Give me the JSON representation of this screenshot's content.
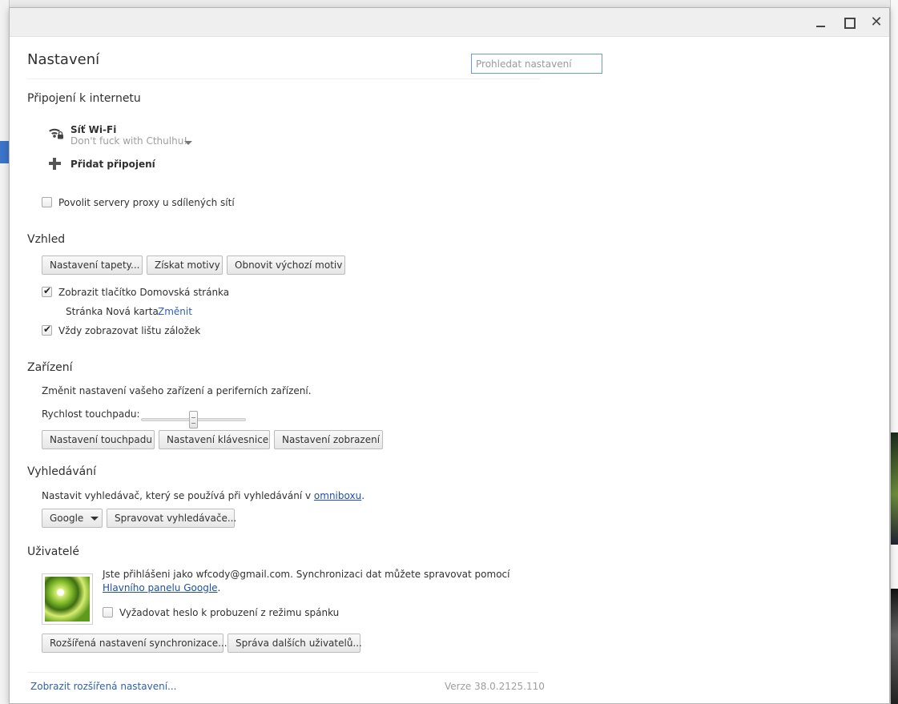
{
  "window": {
    "title": "Nastavení"
  },
  "search": {
    "placeholder": "Prohledat nastavení"
  },
  "internet": {
    "title": "Připojení k internetu",
    "network_name": "Síť Wi-Fi",
    "network_ssid": "Don't fuck with Cthulhu!",
    "add_connection": "Přidat připojení",
    "proxy_label": "Povolit servery proxy u sdílených sítí",
    "proxy_checked": false
  },
  "appearance": {
    "title": "Vzhled",
    "buttons": [
      "Nastavení tapety...",
      "Získat motivy",
      "Obnovit výchozí motiv"
    ],
    "home_button_label": "Zobrazit tlačítko Domovská stránka",
    "home_button_checked": true,
    "home_page_text": "Stránka Nová karta",
    "home_page_change": "Změnit",
    "bookmarks_label": "Vždy zobrazovat lištu záložek",
    "bookmarks_checked": true
  },
  "device": {
    "title": "Zařízení",
    "description": "Změnit nastavení vašeho zařízení a periferních zařízení.",
    "touchpad_speed_label": "Rychlost touchpadu:",
    "touchpad_speed": 0.5,
    "buttons": [
      "Nastavení touchpadu",
      "Nastavení klávesnice",
      "Nastavení zobrazení"
    ]
  },
  "search_section": {
    "title": "Vyhledávání",
    "description_prefix": "Nastavit vyhledávač, který se používá při vyhledávání v ",
    "description_link": "omniboxu",
    "description_suffix": ".",
    "engine": "Google",
    "manage_button": "Spravovat vyhledávače..."
  },
  "users": {
    "title": "Uživatelé",
    "signed_in_text": "Jste přihlášeni jako wfcody@gmail.com. Synchronizaci dat můžete spravovat pomocí",
    "dashboard_link": "Hlavního panelu Google",
    "dashboard_suffix": ".",
    "require_password_label": "Vyžadovat heslo k probuzení z režimu spánku",
    "require_password_checked": false,
    "buttons": [
      "Rozšířená nastavení synchronizace...",
      "Správa dalších uživatelů..."
    ]
  },
  "footer": {
    "advanced_link": "Zobrazit rozšířená nastavení...",
    "version": "Verze 38.0.2125.110"
  }
}
